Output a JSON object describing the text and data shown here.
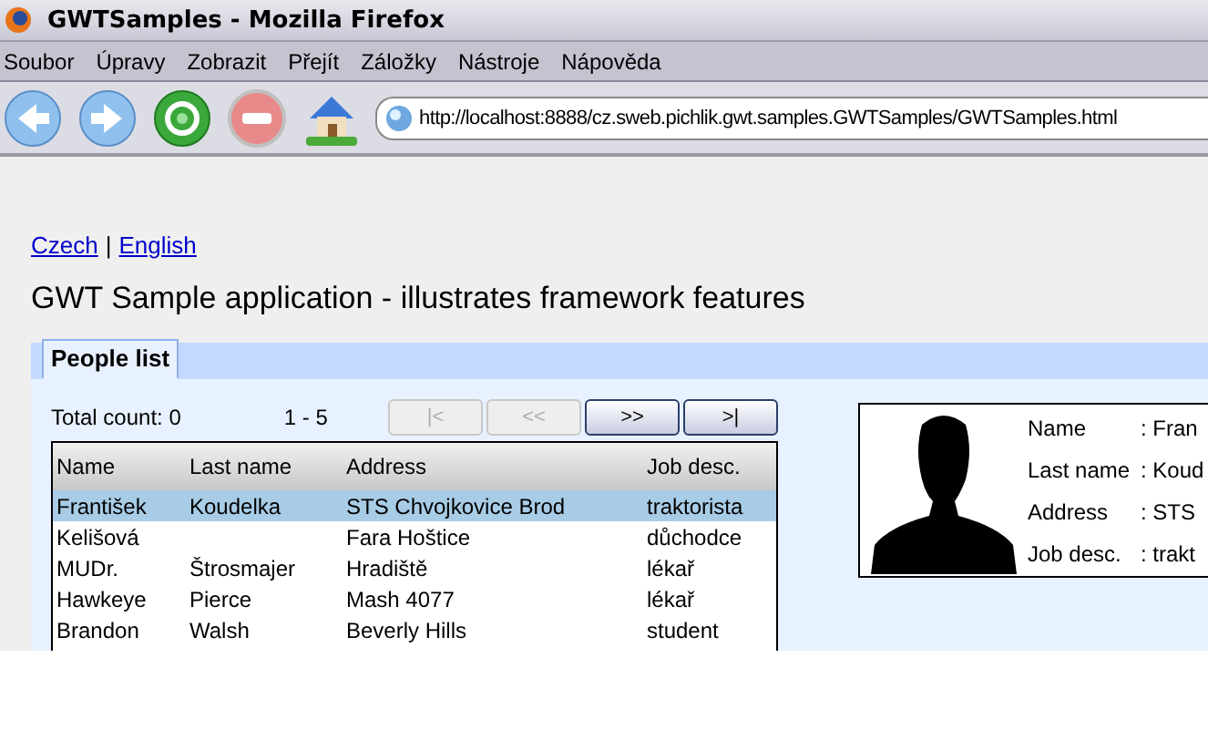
{
  "window": {
    "title": "GWTSamples - Mozilla Firefox"
  },
  "menu": [
    "Soubor",
    "Úpravy",
    "Zobrazit",
    "Přejít",
    "Záložky",
    "Nástroje",
    "Nápověda"
  ],
  "toolbar": {
    "buttons": [
      {
        "kind": "back"
      },
      {
        "kind": "forward"
      },
      {
        "kind": "reload"
      },
      {
        "kind": "stop"
      },
      {
        "kind": "home"
      }
    ],
    "url": "http://localhost:8888/cz.sweb.pichlik.gwt.samples.GWTSamples/GWTSamples.html"
  },
  "languages": [
    "Czech",
    "English"
  ],
  "separator": "|",
  "heading": "GWT Sample application - illustrates framework features",
  "tabs": [
    {
      "label": "People list",
      "selected": true
    }
  ],
  "pager": {
    "total": "Total count: 0",
    "range": "1 - 5",
    "buttons": [
      {
        "label": "|<",
        "disabled": true
      },
      {
        "label": "<<",
        "disabled": true
      },
      {
        "label": ">>",
        "disabled": false
      },
      {
        "label": ">|",
        "disabled": false
      }
    ]
  },
  "table": {
    "columns": [
      "Name",
      "Last name",
      "Address",
      "Job desc."
    ],
    "rows": [
      {
        "cells": [
          "František",
          "Koudelka",
          "STS Chvojkovice Brod",
          "traktorista"
        ],
        "selected": true
      },
      {
        "cells": [
          "Kelišová",
          "",
          "Fara Hoštice",
          "důchodce"
        ],
        "selected": false
      },
      {
        "cells": [
          "MUDr.",
          "Štrosmajer",
          "Hradiště",
          "lékař"
        ],
        "selected": false
      },
      {
        "cells": [
          "Hawkeye",
          "Pierce",
          "Mash 4077",
          "lékař"
        ],
        "selected": false
      },
      {
        "cells": [
          "Brandon",
          "Walsh",
          "Beverly Hills",
          "student"
        ],
        "selected": false
      }
    ]
  },
  "detail": {
    "fields": [
      {
        "label": "Name",
        "value": ": Fran"
      },
      {
        "label": "Last name",
        "value": ": Koud"
      },
      {
        "label": "Address",
        "value": ": STS"
      },
      {
        "label": "Job desc.",
        "value": ": trakt"
      }
    ]
  }
}
